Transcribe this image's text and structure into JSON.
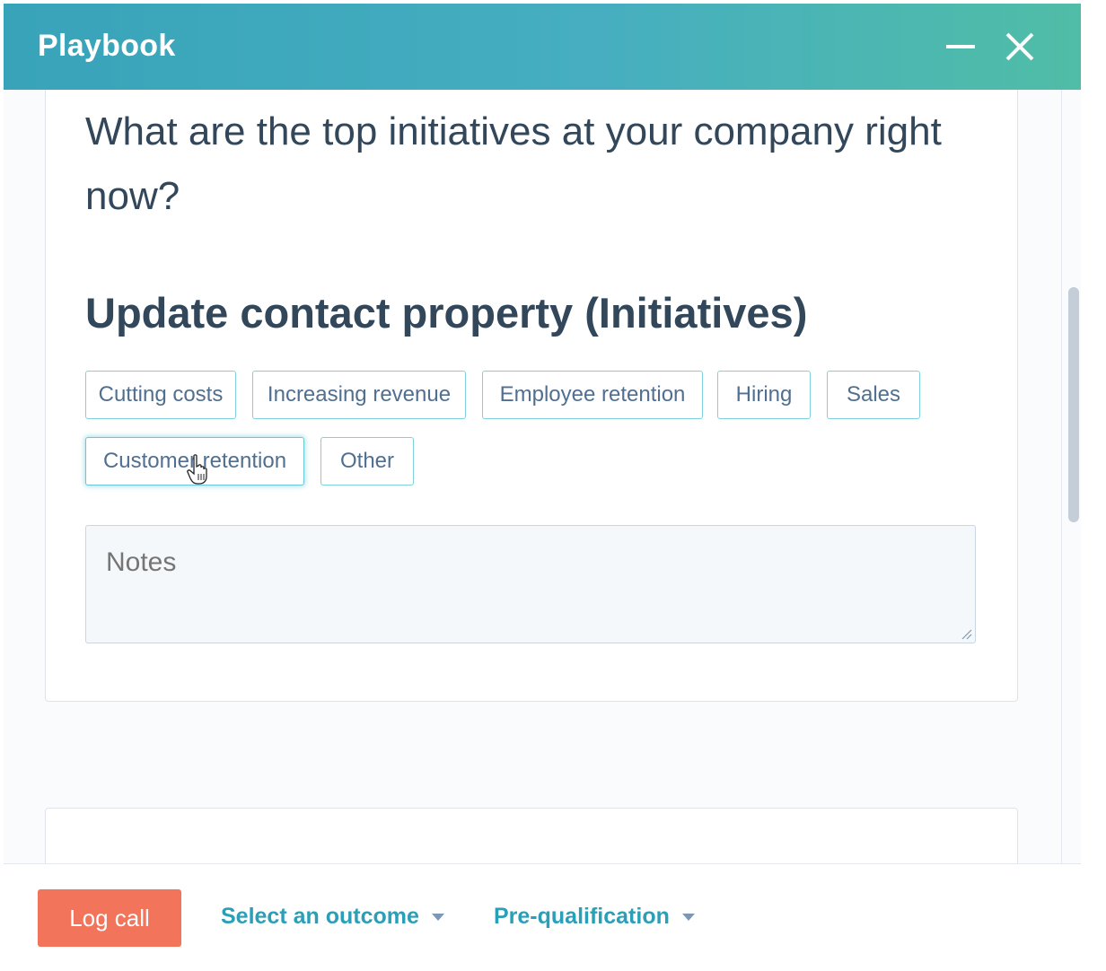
{
  "window": {
    "title": "Playbook"
  },
  "card": {
    "question": "What are the top initiatives at your company right now?",
    "section_title": "Update contact property (Initiatives)",
    "options": [
      "Cutting costs",
      "Increasing revenue",
      "Employee retention",
      "Hiring",
      "Sales",
      "Customer retention",
      "Other"
    ],
    "notes_placeholder": "Notes"
  },
  "footer": {
    "log_call_label": "Log call",
    "outcome_label": "Select an outcome",
    "stage_label": "Pre-qualification"
  },
  "colors": {
    "header_gradient_start": "#38a3b9",
    "header_gradient_end": "#50bda7",
    "log_call_button": "#f2745a",
    "link": "#2b9fb8",
    "chip_border": "#7fd1de"
  },
  "icons": [
    "minimize-icon",
    "close-icon",
    "caret-down-icon",
    "resize-grip-icon",
    "hand-cursor-icon"
  ]
}
